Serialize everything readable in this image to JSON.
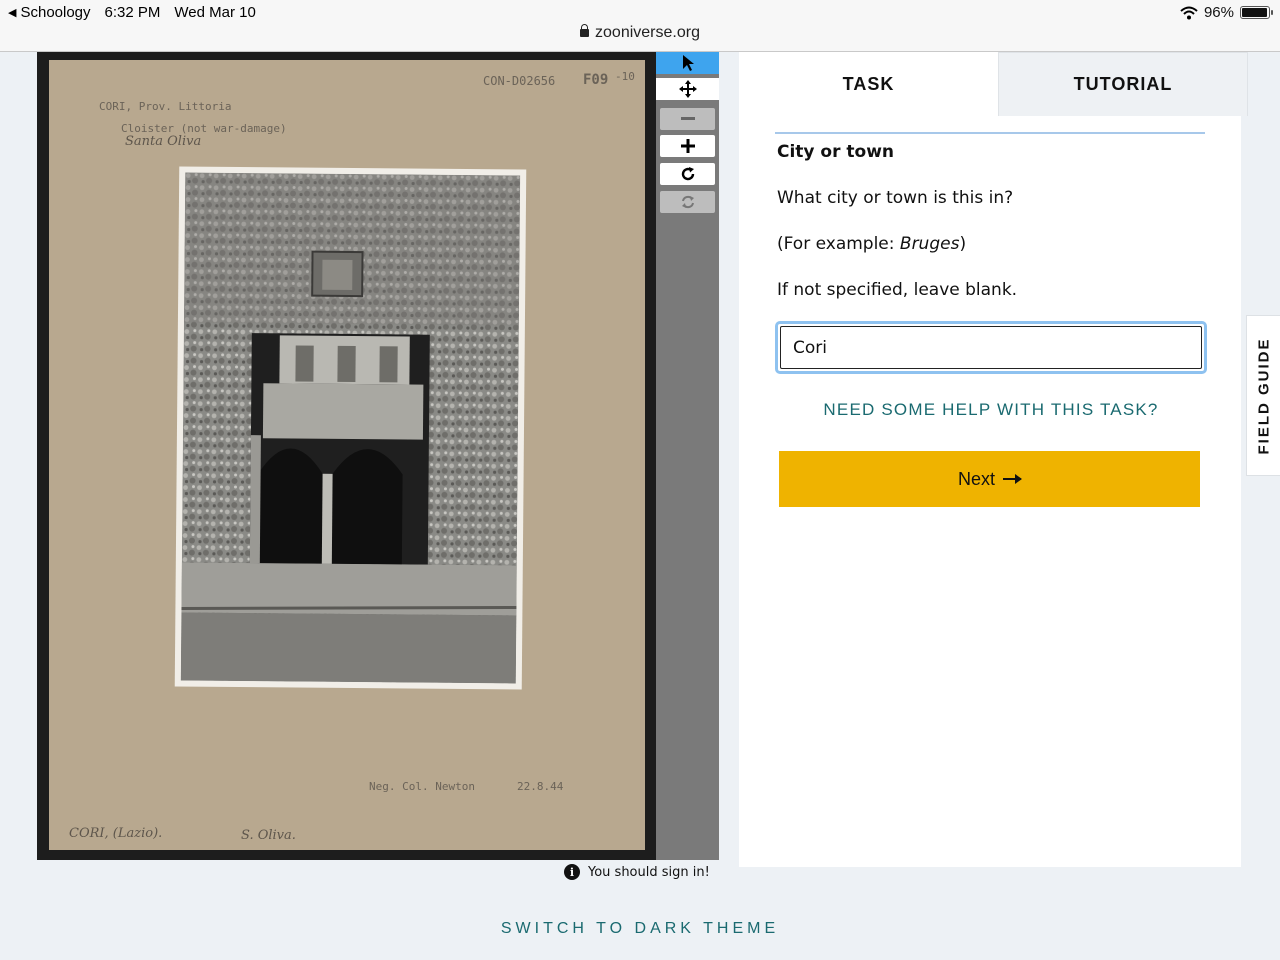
{
  "status_bar": {
    "back_app": "Schoology",
    "time": "6:32 PM",
    "date": "Wed Mar 10",
    "battery": "96%",
    "battery_level": 0.96
  },
  "browser": {
    "url": "zooniverse.org"
  },
  "subject": {
    "card_id": "CON-D02656",
    "card_code": "F09",
    "card_mark": "-10",
    "location_line": "CORI, Prov. Littoria",
    "description_line": "Cloister (not war-damage)",
    "script_line": "Santa Oliva",
    "negative_line": "Neg. Col. Newton",
    "negative_date": "22.8.44",
    "bottom_left": "CORI, (Lazio).",
    "bottom_right": "S. Oliva."
  },
  "toolbar": {
    "items": [
      "pointer-icon",
      "move-icon",
      "zoom-out-icon",
      "zoom-in-icon",
      "rotate-icon",
      "reset-icon"
    ]
  },
  "task_panel": {
    "tabs": [
      {
        "label": "TASK"
      },
      {
        "label": "TUTORIAL"
      }
    ],
    "title": "City or town",
    "question": "What city or town is this in?",
    "example_prefix": "(For example: ",
    "example_value": "Bruges",
    "example_suffix": ")",
    "instruction": "If not specified, leave blank.",
    "answer_value": "Cori",
    "help_link": "NEED SOME HELP WITH THIS TASK?",
    "next_label": "Next"
  },
  "field_guide": {
    "label": "FIELD GUIDE"
  },
  "notice": "You should sign in!",
  "footer": {
    "theme_toggle": "SWITCH TO DARK THEME"
  },
  "colors": {
    "accent_next": "#efb300",
    "link_teal": "#1a6a70",
    "active_tool": "#3ea4ee",
    "focus_ring": "#8ec2f0"
  }
}
